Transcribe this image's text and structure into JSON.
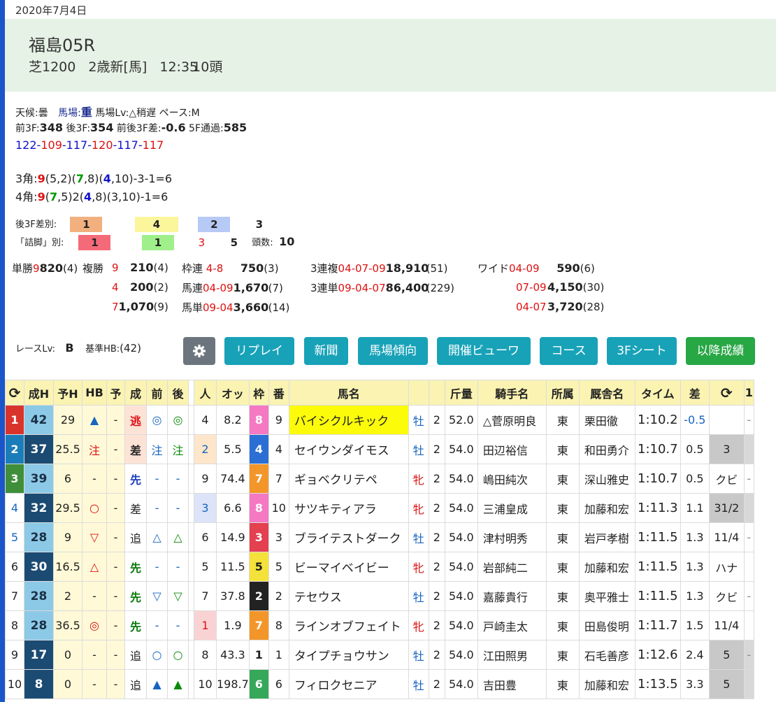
{
  "date": "2020年7月4日",
  "race": {
    "title": "福島05R",
    "course": "芝1200",
    "cond": "2歳新[馬]",
    "time": "12:35",
    "heads": "10頭"
  },
  "info": {
    "weather_label": "天候:",
    "weather": "曇",
    "track_label": "馬場:",
    "track": "重",
    "tracklv_label": "馬場Lv:",
    "tracklv": "△稍遅",
    "pace_label": "ペース:",
    "pace": "M",
    "f3_label": "前3F:",
    "f3": "348",
    "l3_label": "後3F:",
    "l3": "354",
    "diff_label": "前後3F差:",
    "diff": "-0.6",
    "f5_label": "5F通過:",
    "f5": "585",
    "laps": [
      "122",
      "109",
      "117",
      "120",
      "117",
      "117"
    ],
    "c3": [
      "3角:",
      "9",
      "(5,2)(",
      "7",
      ",8)(",
      "4",
      ",10)-3-1=6"
    ],
    "c4": [
      "4角:",
      "9",
      "(",
      "7",
      ",5)2(",
      "4",
      ",8)(3,10)-1=6"
    ]
  },
  "stats": {
    "l3_label": "後3F差別:",
    "l3_vals": [
      "1",
      "4",
      "2",
      "3"
    ],
    "tsume_label": "「詰脚」別:",
    "tsume_vals": [
      "1",
      "1",
      "3",
      "5"
    ],
    "heads_label": "頭数:",
    "heads": "10"
  },
  "payouts": {
    "tan_label": "単勝",
    "tan": [
      "9",
      "820",
      "(4)"
    ],
    "fuku_label": "複勝",
    "fuku": [
      [
        "9",
        "210",
        "(4)"
      ],
      [
        "4",
        "200",
        "(2)"
      ],
      [
        "7",
        "1,070",
        "(9)"
      ]
    ],
    "wakuren": [
      "枠連",
      "4-8",
      "750",
      "(3)"
    ],
    "umaren": [
      "馬連",
      "04-09",
      "1,670",
      "(7)"
    ],
    "umatan": [
      "馬単",
      "09-04",
      "3,660",
      "(14)"
    ],
    "sanfuku": [
      "3連複",
      "04-07-09",
      "18,910",
      "(51)"
    ],
    "santan": [
      "3連単",
      "09-04-07",
      "86,400",
      "(229)"
    ],
    "wide_label": "ワイド",
    "wide": [
      [
        "04-09",
        "590",
        "(6)"
      ],
      [
        "07-09",
        "4,150",
        "(30)"
      ],
      [
        "04-07",
        "3,720",
        "(28)"
      ]
    ]
  },
  "racelv": {
    "label": "レースLv:",
    "value": "B",
    "hb_label": "基準HB:",
    "hb": "(42)"
  },
  "buttons": [
    "リプレイ",
    "新聞",
    "馬場傾向",
    "開催ビューワ",
    "コース",
    "3Fシート",
    "以降成績"
  ],
  "table": {
    "headers": [
      "⟳",
      "成H",
      "予H",
      "HB",
      "予",
      "成",
      "前",
      "後",
      "",
      "人",
      "オッ",
      "枠",
      "番",
      "馬名",
      "",
      "",
      "斤量",
      "騎手名",
      "所属",
      "厩舎名",
      "タイム",
      "差",
      "⟳",
      "1"
    ],
    "rows": [
      [
        "1",
        "42",
        "29",
        "▲",
        "-",
        "逃",
        "◎",
        "◎",
        "",
        "4",
        "8.2",
        "8",
        "9",
        "バイシクルキック",
        "牡",
        "2",
        "52.0",
        "△菅原明良",
        "東",
        "栗田徹",
        "1:10.2",
        "-0.5",
        "",
        ""
      ],
      [
        "2",
        "37",
        "25.5",
        "注",
        "-",
        "差",
        "注",
        "注",
        "",
        "2",
        "5.5",
        "4",
        "4",
        "セイウンダイモス",
        "牡",
        "2",
        "54.0",
        "田辺裕信",
        "東",
        "和田勇介",
        "1:10.7",
        "0.5",
        "3",
        ""
      ],
      [
        "3",
        "39",
        "6",
        "-",
        "-",
        "先",
        "-",
        "-",
        "",
        "9",
        "74.4",
        "7",
        "7",
        "ギョベクリテペ",
        "牝",
        "2",
        "54.0",
        "嶋田純次",
        "東",
        "深山雅史",
        "1:10.7",
        "0.5",
        "クビ",
        ""
      ],
      [
        "4",
        "32",
        "29.5",
        "○",
        "-",
        "差",
        "-",
        "-",
        "",
        "3",
        "6.6",
        "8",
        "10",
        "サツキティアラ",
        "牝",
        "2",
        "54.0",
        "三浦皇成",
        "東",
        "加藤和宏",
        "1:11.3",
        "1.1",
        "31/2",
        ""
      ],
      [
        "5",
        "28",
        "9",
        "▽",
        "-",
        "追",
        "△",
        "△",
        "",
        "6",
        "14.9",
        "3",
        "3",
        "ブライテストダーク",
        "牡",
        "2",
        "54.0",
        "津村明秀",
        "東",
        "岩戸孝樹",
        "1:11.5",
        "1.3",
        "11/4",
        ""
      ],
      [
        "6",
        "30",
        "16.5",
        "△",
        "-",
        "先",
        "-",
        "-",
        "",
        "5",
        "11.5",
        "5",
        "5",
        "ビーマイベイビー",
        "牝",
        "2",
        "54.0",
        "岩部純二",
        "東",
        "加藤和宏",
        "1:11.5",
        "1.3",
        "ハナ",
        ""
      ],
      [
        "7",
        "28",
        "2",
        "-",
        "-",
        "先",
        "▽",
        "▽",
        "",
        "7",
        "37.8",
        "2",
        "2",
        "テセウス",
        "牡",
        "2",
        "54.0",
        "嘉藤貴行",
        "東",
        "奥平雅士",
        "1:11.5",
        "1.3",
        "クビ",
        ""
      ],
      [
        "8",
        "28",
        "36.5",
        "◎",
        "-",
        "先",
        "-",
        "-",
        "",
        "1",
        "1.9",
        "7",
        "8",
        "ラインオブフェイト",
        "牝",
        "2",
        "54.0",
        "戸崎圭太",
        "東",
        "田島俊明",
        "1:11.7",
        "1.5",
        "11/4",
        ""
      ],
      [
        "9",
        "17",
        "0",
        "-",
        "-",
        "追",
        "○",
        "○",
        "",
        "8",
        "43.3",
        "1",
        "1",
        "タイプチョウサン",
        "牡",
        "2",
        "54.0",
        "江田照男",
        "東",
        "石毛善彦",
        "1:12.6",
        "2.4",
        "5",
        ""
      ],
      [
        "10",
        "8",
        "0",
        "-",
        "-",
        "追",
        "▲",
        "▲",
        "",
        "10",
        "198.7",
        "6",
        "6",
        "フィロクセニア",
        "牡",
        "2",
        "54.0",
        "吉田豊",
        "東",
        "加藤和宏",
        "1:13.5",
        "3.3",
        "5",
        ""
      ]
    ]
  }
}
